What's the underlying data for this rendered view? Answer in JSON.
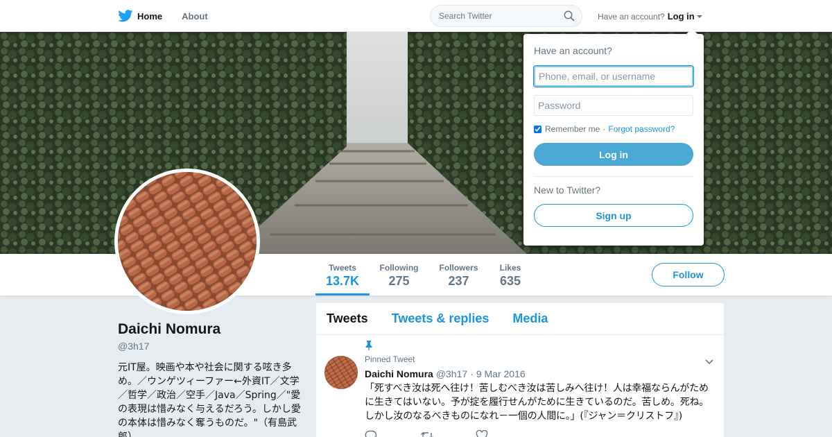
{
  "nav": {
    "home_label": "Home",
    "about_label": "About",
    "search_placeholder": "Search Twitter",
    "have_account_text": "Have an account?",
    "login_label": "Log in"
  },
  "profile": {
    "name": "Daichi Nomura",
    "handle": "@3h17",
    "bio": "元IT屋。映画や本や社会に関する呟き多め。／ウンゲツィーファー←外資IT／文学／哲学／政治／空手／Java／Spring／\"愛の表現は惜みなく与えるだろう。しかし愛の本体は惜みなく奪うものだ。\"（有島武郎）",
    "follow_label": "Follow"
  },
  "stats": [
    {
      "label": "Tweets",
      "value": "13.7K"
    },
    {
      "label": "Following",
      "value": "275"
    },
    {
      "label": "Followers",
      "value": "237"
    },
    {
      "label": "Likes",
      "value": "635"
    }
  ],
  "timeline": {
    "tabs": [
      "Tweets",
      "Tweets & replies",
      "Media"
    ],
    "tweet": {
      "pinned_label": "Pinned Tweet",
      "name": "Daichi Nomura",
      "handle": "@3h17",
      "separator": "·",
      "date": "9 Mar 2016",
      "text": "「死すべき汝は死へ往け！苦しむべき汝は苦しみへ往け！人は幸福ならんがために生きてはいない。予が掟を履行せんがために生きているのだ。苦しめ。死ね。しかし汝のなるべきものになれ－一個の人間に。」(『ジャン＝クリストフ』)"
    }
  },
  "login_dropdown": {
    "title": "Have an account?",
    "username_placeholder": "Phone, email, or username",
    "password_placeholder": "Password",
    "remember_label": "Remember me",
    "separator": "·",
    "forgot_label": "Forgot password?",
    "login_button": "Log in",
    "new_text": "New to Twitter?",
    "signup_button": "Sign up"
  },
  "colors": {
    "brand_blue": "#1da1f2",
    "link_blue": "#1b95e0",
    "login_button_bg": "#4ba9d6"
  },
  "icons": [
    "twitter-bird-icon",
    "search-icon",
    "caret-down-icon",
    "pin-icon",
    "chevron-down-icon",
    "reply-icon",
    "retweet-icon",
    "like-icon"
  ]
}
